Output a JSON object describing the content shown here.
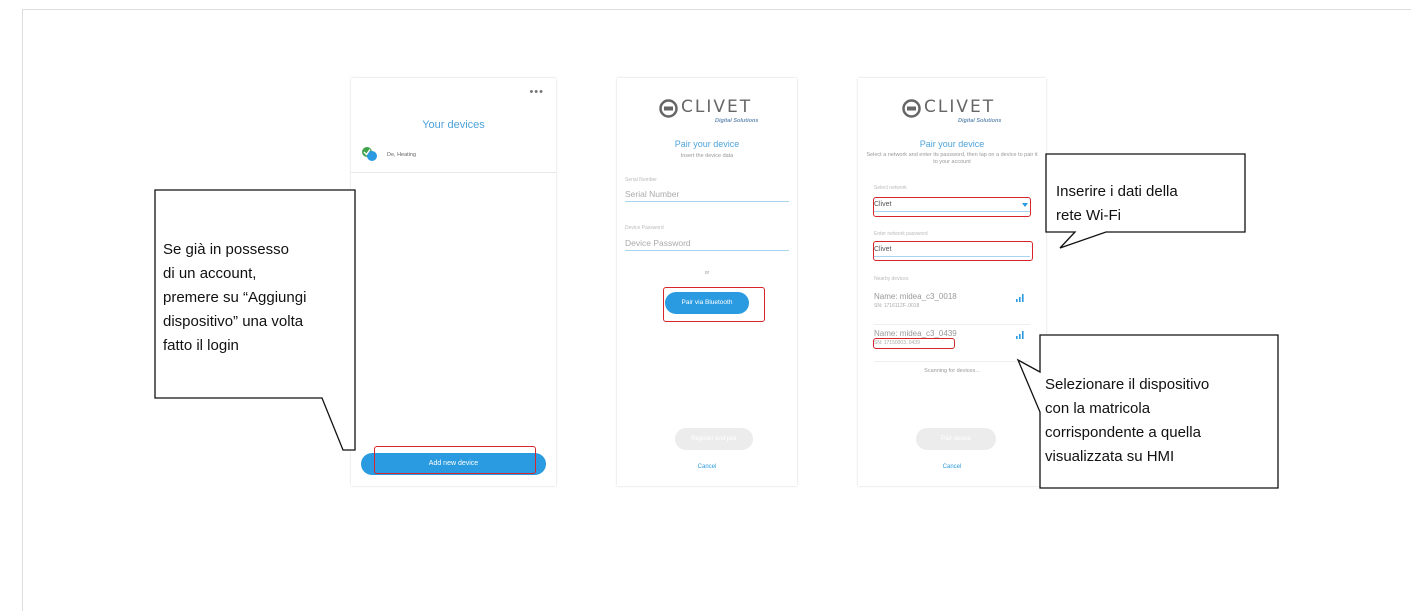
{
  "screen1": {
    "menu_dots": "•••",
    "title": "Your devices",
    "device_name": "De, Heating",
    "add_button": "Add new device"
  },
  "screen2": {
    "logo_word": "CLIVET",
    "logo_tagline": "Digital Solutions",
    "title": "Pair your device",
    "subtitle": "Insert the device data",
    "serial_label": "Serial Number",
    "serial_placeholder": "Serial Number",
    "password_label": "Device Password",
    "password_placeholder": "Device Password",
    "or_text": "or",
    "bluetooth_button": "Pair via Bluetooth",
    "register_button": "Register and pair",
    "cancel": "Cancel"
  },
  "screen3": {
    "logo_word": "CLIVET",
    "logo_tagline": "Digital Solutions",
    "title": "Pair your device",
    "subtitle": "Select a network and enter its password, then tap on a device to pair it to your account",
    "network_label": "Select network",
    "network_value": "Clivet",
    "netpass_label": "Enter network password",
    "netpass_value": "Clivet",
    "nearby_label": "Nearby devices",
    "devices": [
      {
        "name": "Name: midea_c3_0018",
        "sn": "SN: 1716112F..0018"
      },
      {
        "name": "Name: midea_c3_0439",
        "sn": "SN: 17150003..0439"
      }
    ],
    "scanning": "Scanning for devices...",
    "pair_button": "Pair device",
    "cancel": "Cancel"
  },
  "callouts": {
    "login": "Se già in possesso\ndi un account,\npremere su “Aggiungi\ndispositivo” una volta\nfatto il login",
    "wifi": "Inserire i dati della\nrete Wi-Fi",
    "select": "Selezionare il dispositivo\ncon la matricola\ncorrispondente a quella\nvisualizzata su HMI"
  },
  "colors": {
    "accent_blue": "#2a9be0",
    "highlight_red": "#d9242b",
    "title_blue": "#4ea3dc"
  }
}
